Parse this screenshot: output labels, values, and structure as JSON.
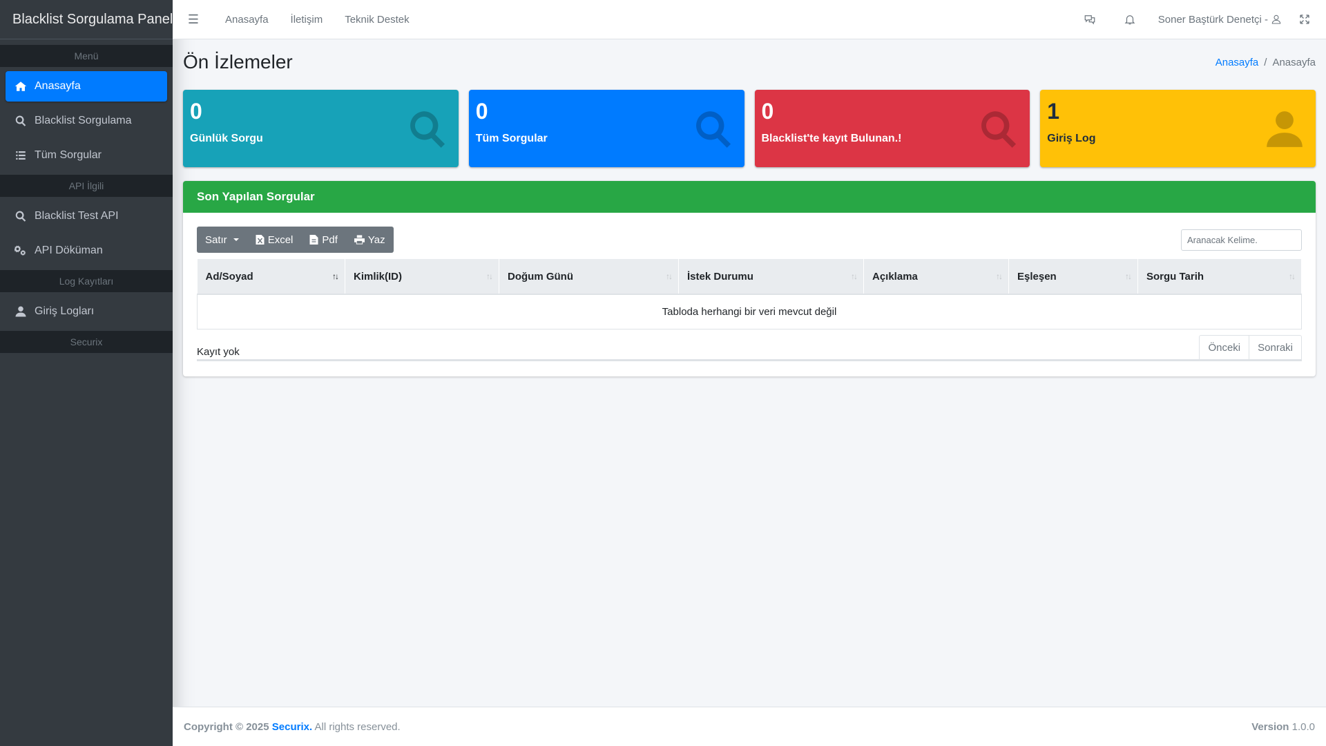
{
  "sidebar": {
    "brand": "Blacklist Sorgulama Paneli",
    "headers": [
      "Menü",
      "API İlgili",
      "Log Kayıtları",
      "Securix"
    ],
    "items": [
      {
        "label": "Anasayfa",
        "icon": "home-icon"
      },
      {
        "label": "Blacklist Sorgulama",
        "icon": "search-icon"
      },
      {
        "label": "Tüm Sorgular",
        "icon": "list-icon"
      },
      {
        "label": "Blacklist Test API",
        "icon": "search-icon"
      },
      {
        "label": "API Döküman",
        "icon": "cogs-icon"
      },
      {
        "label": "Giriş Logları",
        "icon": "user-icon"
      }
    ]
  },
  "topbar": {
    "links": [
      "Anasayfa",
      "İletişim",
      "Teknik Destek"
    ],
    "user": "Soner Baştürk Denetçi -"
  },
  "header": {
    "title": "Ön İzlemeler",
    "breadcrumb": [
      "Anasayfa",
      "Anasayfa"
    ]
  },
  "stats": [
    {
      "value": "0",
      "label": "Günlük Sorgu",
      "color": "#17a2b8"
    },
    {
      "value": "0",
      "label": "Tüm Sorgular",
      "color": "#007bff"
    },
    {
      "value": "0",
      "label": "Blacklist'te kayıt Bulunan.!",
      "color": "#dc3545"
    },
    {
      "value": "1",
      "label": "Giriş Log",
      "color": "#ffc107"
    }
  ],
  "card": {
    "title": "Son Yapılan Sorgular",
    "buttons": {
      "rows": "Satır",
      "excel": "Excel",
      "pdf": "Pdf",
      "print": "Yaz"
    },
    "search_placeholder": "Aranacak Kelime.",
    "columns": [
      "Ad/Soyad",
      "Kimlik(ID)",
      "Doğum Günü",
      "İstek Durumu",
      "Açıklama",
      "Eşleşen",
      "Sorgu Tarih"
    ],
    "empty": "Tabloda herhangi bir veri mevcut değil",
    "info": "Kayıt yok",
    "prev": "Önceki",
    "next": "Sonraki"
  },
  "footer": {
    "copyright": "Copyright © 2025",
    "brand": "Securix.",
    "rights": "All rights reserved.",
    "version_label": "Version",
    "version": "1.0.0"
  }
}
